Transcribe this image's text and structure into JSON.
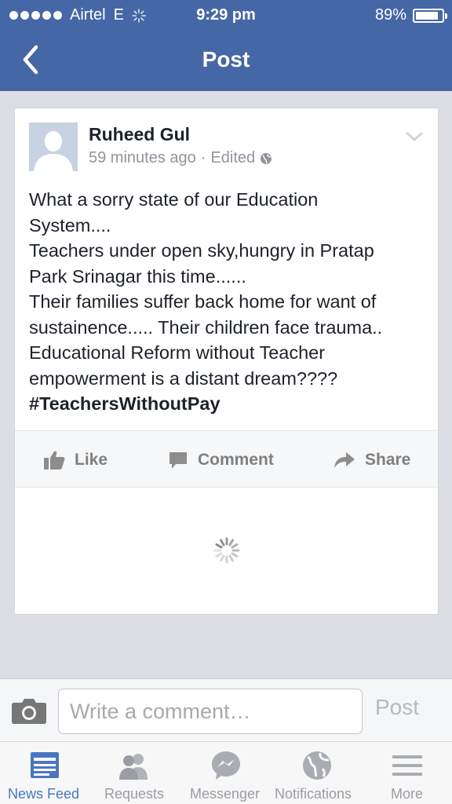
{
  "status_bar": {
    "carrier": "Airtel",
    "network": "E",
    "time": "9:29 pm",
    "battery": "89%",
    "battery_level": 0.89
  },
  "nav": {
    "title": "Post"
  },
  "post": {
    "author": "Ruheed Gul",
    "time_ago": "59 minutes ago",
    "separator": "·",
    "edited": "Edited",
    "lines": [
      "What a sorry state of our Education",
      "System....",
      "Teachers under open sky,hungry in Pratap",
      "Park Srinagar this time......",
      "Their families suffer back home for want of",
      "sustainence..... Their children face trauma..",
      "Educational Reform without Teacher",
      "empowerment is a distant dream????"
    ],
    "hashtag": "#TeachersWithoutPay"
  },
  "actions": {
    "like": "Like",
    "comment": "Comment",
    "share": "Share"
  },
  "composer": {
    "placeholder": "Write a comment…",
    "post_label": "Post"
  },
  "tabs": [
    {
      "label": "News Feed",
      "icon": "news-feed-icon",
      "active": true
    },
    {
      "label": "Requests",
      "icon": "friend-requests-icon",
      "active": false
    },
    {
      "label": "Messenger",
      "icon": "messenger-icon",
      "active": false
    },
    {
      "label": "Notifications",
      "icon": "globe-icon",
      "active": false
    },
    {
      "label": "More",
      "icon": "menu-icon",
      "active": false
    }
  ],
  "colors": {
    "header_blue": "#4567a6",
    "active_tab_blue": "#4a76c1",
    "inactive_gray": "#9a9da3"
  }
}
